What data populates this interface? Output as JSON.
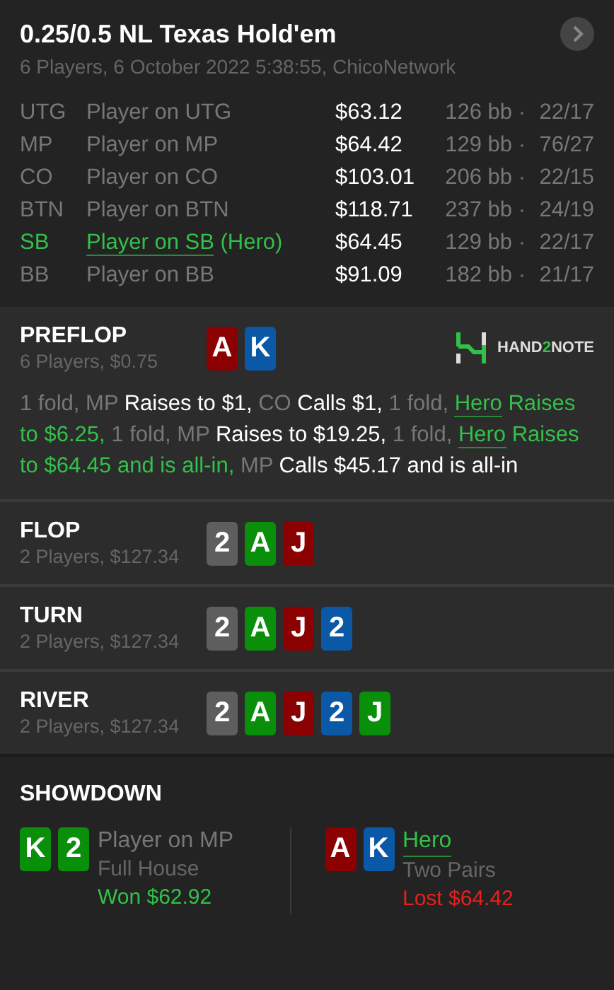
{
  "header": {
    "title": "0.25/0.5 NL Texas Hold'em",
    "subtitle": "6 Players, 6 October 2022 5:38:55, ChicoNetwork"
  },
  "players": [
    {
      "position": "UTG",
      "name": "Player on UTG",
      "stack": "$63.12",
      "bb": "126 bb",
      "stats": "22/17",
      "hero": false
    },
    {
      "position": "MP",
      "name": "Player on MP",
      "stack": "$64.42",
      "bb": "129 bb",
      "stats": "76/27",
      "hero": false
    },
    {
      "position": "CO",
      "name": "Player on CO",
      "stack": "$103.01",
      "bb": "206 bb",
      "stats": "22/15",
      "hero": false
    },
    {
      "position": "BTN",
      "name": "Player on BTN",
      "stack": "$118.71",
      "bb": "237 bb",
      "stats": "24/19",
      "hero": false
    },
    {
      "position": "SB",
      "name": "Player on SB",
      "tag": "(Hero)",
      "stack": "$64.45",
      "bb": "129 bb",
      "stats": "22/17",
      "hero": true
    },
    {
      "position": "BB",
      "name": "Player on BB",
      "stack": "$91.09",
      "bb": "182 bb",
      "stats": "21/17",
      "hero": false
    }
  ],
  "streets": [
    {
      "name": "PREFLOP",
      "info": "6 Players, $0.75",
      "cards": [
        {
          "rank": "A",
          "color": "#8b0000"
        },
        {
          "rank": "K",
          "color": "#0a58a6"
        }
      ],
      "logo": {
        "before": "HAND",
        "accent": "2",
        "after": "NOTE"
      },
      "actions": [
        {
          "kind": "muted",
          "text": "1 fold, MP "
        },
        {
          "kind": "normal",
          "text": "Raises to $1, "
        },
        {
          "kind": "muted",
          "text": "CO "
        },
        {
          "kind": "normal",
          "text": "Calls $1, "
        },
        {
          "kind": "muted",
          "text": "1 fold, "
        },
        {
          "kind": "hero-link",
          "text": "Hero"
        },
        {
          "kind": "hero",
          "text": " Raises to $6.25, "
        },
        {
          "kind": "muted",
          "text": "1 fold, MP "
        },
        {
          "kind": "normal",
          "text": "Raises to $19.25, "
        },
        {
          "kind": "muted",
          "text": "1 fold, "
        },
        {
          "kind": "hero-link",
          "text": "Hero"
        },
        {
          "kind": "hero",
          "text": " Raises to $64.45 and is all-in, "
        },
        {
          "kind": "muted",
          "text": "MP "
        },
        {
          "kind": "normal",
          "text": "Calls $45.17 and is all-in"
        }
      ]
    },
    {
      "name": "FLOP",
      "info": "2 Players, $127.34",
      "cards": [
        {
          "rank": "2",
          "color": "#5e5e5e"
        },
        {
          "rank": "A",
          "color": "#0a8f0a"
        },
        {
          "rank": "J",
          "color": "#8b0000"
        }
      ]
    },
    {
      "name": "TURN",
      "info": "2 Players, $127.34",
      "cards": [
        {
          "rank": "2",
          "color": "#5e5e5e"
        },
        {
          "rank": "A",
          "color": "#0a8f0a"
        },
        {
          "rank": "J",
          "color": "#8b0000"
        },
        {
          "rank": "2",
          "color": "#0a58a6"
        }
      ]
    },
    {
      "name": "RIVER",
      "info": "2 Players, $127.34",
      "cards": [
        {
          "rank": "2",
          "color": "#5e5e5e"
        },
        {
          "rank": "A",
          "color": "#0a8f0a"
        },
        {
          "rank": "J",
          "color": "#8b0000"
        },
        {
          "rank": "2",
          "color": "#0a58a6"
        },
        {
          "rank": "J",
          "color": "#0a8f0a"
        }
      ]
    }
  ],
  "showdown": {
    "title": "SHOWDOWN",
    "hands": [
      {
        "cards": [
          {
            "rank": "K",
            "color": "#0a8f0a"
          },
          {
            "rank": "2",
            "color": "#0a8f0a"
          }
        ],
        "name": "Player on MP",
        "hero": false,
        "hand": "Full House",
        "result": "Won $62.92",
        "won": true
      },
      {
        "cards": [
          {
            "rank": "A",
            "color": "#8b0000"
          },
          {
            "rank": "K",
            "color": "#0a58a6"
          }
        ],
        "name": "Hero",
        "hero": true,
        "hand": "Two Pairs",
        "result": "Lost $64.42",
        "won": false
      }
    ]
  }
}
